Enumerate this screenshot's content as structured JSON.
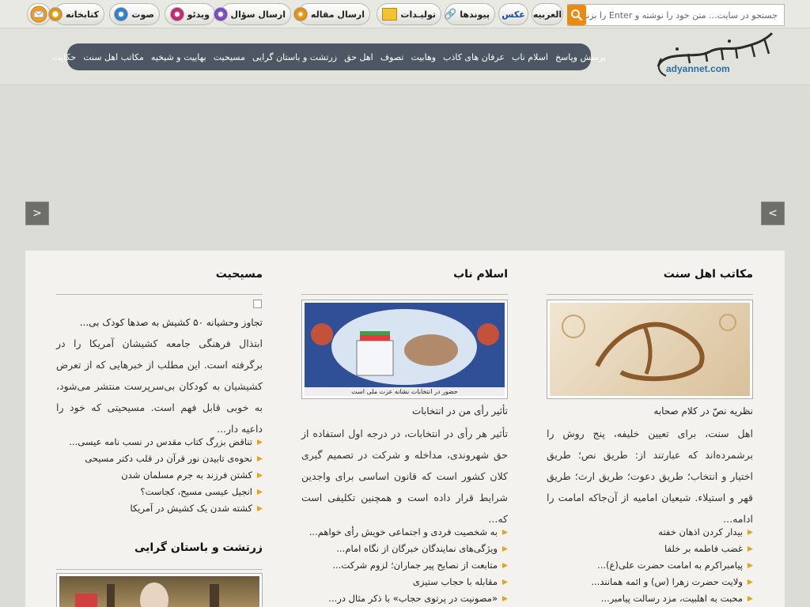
{
  "search": {
    "placeholder": "جستجو در سایت...  متن خود را نوشته و Enter را بزنید"
  },
  "topnav": [
    {
      "label": "العربیه"
    },
    {
      "label": "عکس"
    },
    {
      "label": "پیوندها"
    },
    {
      "label": "تولیـدات"
    },
    {
      "label": "ارسال مقاله"
    },
    {
      "label": "ارسال سؤال"
    },
    {
      "label": "ویدئو"
    },
    {
      "label": "صوت"
    },
    {
      "label": "کتابخانه"
    }
  ],
  "logo": {
    "text": "adyannet.com",
    "calligraphy": "پایگاه معرفت ادیان"
  },
  "categories": [
    "پرسش وپاسخ",
    "اسلام ناب",
    "عرفان های کاذب",
    "وهابیت",
    "تصوف",
    "اهل حق",
    "زرتشت و باستان گرایی",
    "مسیحیت",
    "بهاییت و شیخیه",
    "مکاتب اهل سنت",
    "حکایت"
  ],
  "slider": {
    "prev": ">",
    "next": "<"
  },
  "columns": {
    "right": {
      "title": "مکاتب اهل سنت",
      "article_title": "نظریه نصّ در کلام صحابه",
      "article_body": "اهل سنت، برای تعیین خلیفه، پنج روش را برشمرده‌اند که عبارتند از: طریق نص؛ طریق اختیار و انتخاب؛ طریق دعوت؛ طریق ارث؛ طریق قهر و استیلاء. شیعیان امامیه از آن‌جاکه امامت را ادامه...",
      "links": [
        "بیدار کردن اذهان خفته",
        "غضب فاطمه بر خلفا",
        "پیامبراکرم به امامت حضرت علی(ع)...",
        "ولایت حضرت زهرا (س) و ائمه همانند...",
        "محبت به اهلبیت، مزد رسالت پیامبر..."
      ]
    },
    "middle": {
      "title": "اسلام ناب",
      "image_caption": "حضور در انتخابات نشانه عزت ملی است",
      "article_title": "تأثیر رأی من در انتخابات",
      "article_body": "تأثیر هر رأی در انتخابات، در درجه اول استفاده از حق شهروندی، مداخله و شرکت در تصمیم گیری کلان کشور است که قانون اساسی برای واجدین شرایط قرار داده است و همچنین تکلیفی است که...",
      "links": [
        "به شخصیت فردی و اجتماعی خویش رأی خواهم...",
        "ویژگی‌های نمایندگان خبرگان از نگاه امام...",
        "متابعت از نصایح پیر جماران؛ لزوم شرکت...",
        "مقابله با حجاب ستیزی",
        "«مصونیت در پرتوی حجاب» با ذکر مثال در..."
      ]
    },
    "left": {
      "title": "مسیحیت",
      "article_title": "تجاوز وحشیانه ۵۰ کشیش به صدها کودک بی...",
      "article_body": "ابتذال فرهنگی جامعه کشیشان آمریکا را در برگرفته است. این مطلب از خبرهایی که از تعرض کشیشیان به کودکان بی‌سرپرست منتشر می‌شود، به خوبی قابل فهم است. مسیحیتی که خود را داعیه دار...",
      "links": [
        "تناقض بزرگ کتاب مقدس در نسب نامه عیسی...",
        "نحوه‌ی تابیدن نور قرآن در قلب دکتر مسیحی",
        "کشتن فرزند به جرم مسلمان شدن",
        "انجیل عیسی مسیح، کجاست؟",
        "کشته شدن یک کشیش در آمریکا"
      ],
      "title2": "زرتشت و باستان گرایی"
    }
  },
  "colors": {
    "accent": "#e88a14",
    "catbar": "#4d5763",
    "bullet": "#e8a317",
    "link_active": "#1a4da8"
  }
}
